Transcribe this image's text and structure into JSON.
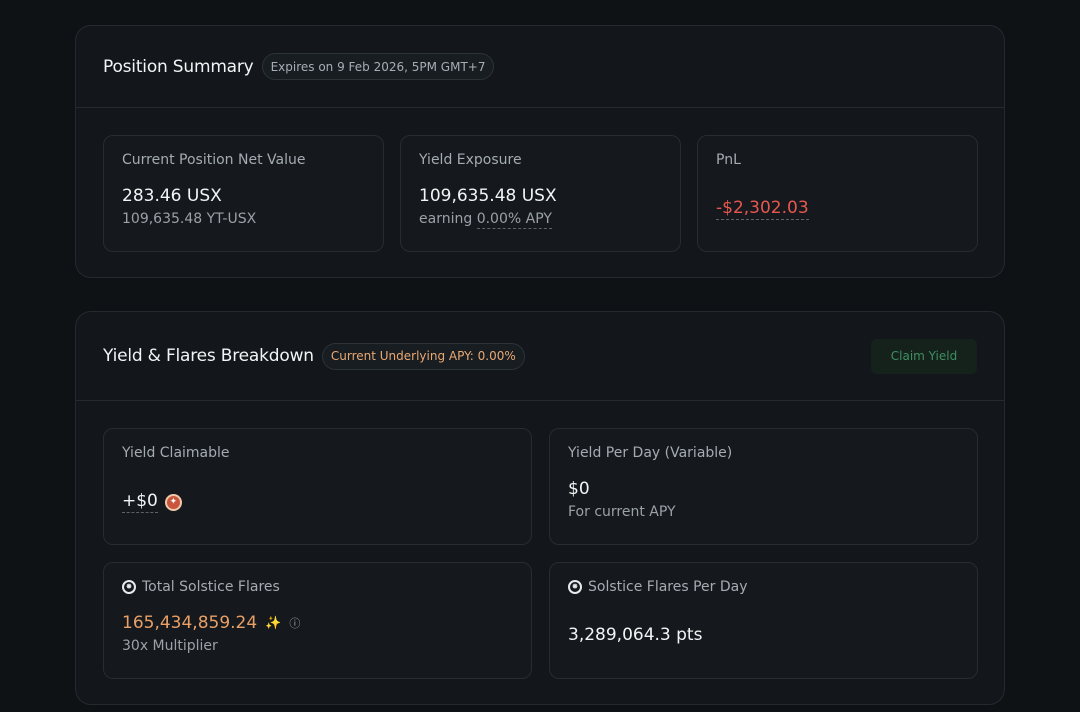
{
  "position_summary": {
    "title": "Position Summary",
    "expiry": "Expires on 9 Feb 2026, 5PM GMT+7",
    "cards": {
      "net_value": {
        "label": "Current Position Net Value",
        "value": "283.46 USX",
        "sub": "109,635.48 YT-USX"
      },
      "yield_exposure": {
        "label": "Yield Exposure",
        "value": "109,635.48 USX",
        "sub_prefix": "earning",
        "sub_apy": "0.00% APY"
      },
      "pnl": {
        "label": "PnL",
        "value": "-$2,302.03"
      }
    }
  },
  "breakdown": {
    "title": "Yield & Flares Breakdown",
    "apy_pill": "Current Underlying APY: 0.00%",
    "claim_label": "Claim Yield",
    "cards": {
      "yield_claimable": {
        "label": "Yield Claimable",
        "value": "+$0"
      },
      "yield_per_day": {
        "label": "Yield Per Day (Variable)",
        "value": "$0",
        "sub": "For current APY"
      },
      "total_flares": {
        "label": "Total Solstice Flares",
        "value": "165,434,859.24",
        "sub": "30x Multiplier"
      },
      "flares_per_day": {
        "label": "Solstice Flares Per Day",
        "value": "3,289,064.3 pts"
      }
    }
  },
  "colors": {
    "accent_orange": "#e9a066",
    "negative_red": "#e8574f",
    "claim_green": "#3e8e61"
  },
  "icons": {
    "flare": "solstice-flare-icon",
    "coin": "usx-coin-icon",
    "sparkle": "sparkle-icon",
    "info": "info-icon"
  }
}
